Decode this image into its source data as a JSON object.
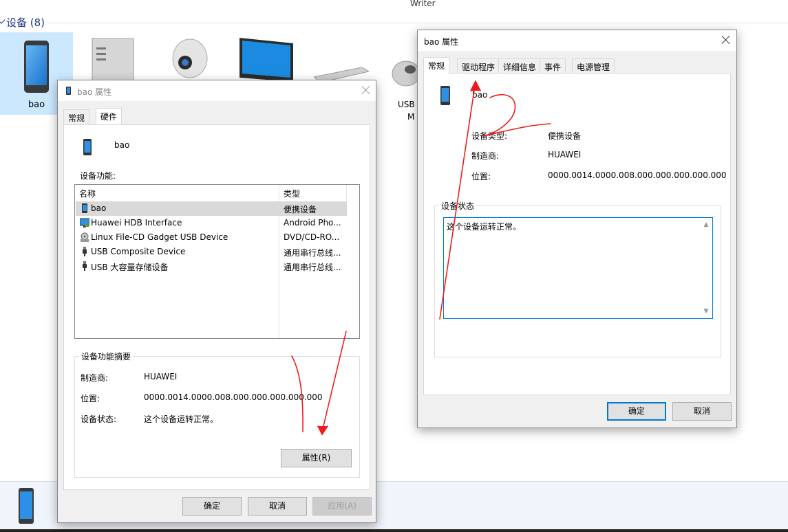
{
  "window": {
    "title": "Writer"
  },
  "section": {
    "header": "设备 (8)"
  },
  "devices": [
    {
      "label": "bao",
      "icon": "phone-icon"
    },
    {
      "label": "",
      "icon": "tower-pc-icon"
    },
    {
      "label": "",
      "icon": "webcam-icon"
    },
    {
      "label": "",
      "icon": "monitor-icon"
    },
    {
      "label": "",
      "icon": "keyboard-icon"
    },
    {
      "label_line1": "USB",
      "label_line2": "M",
      "icon": "mouse-icon"
    }
  ],
  "dialog_left": {
    "title": "bao 属性",
    "tabs": [
      "常规",
      "硬件"
    ],
    "active_tab": "硬件",
    "device_name": "bao",
    "functions_label": "设备功能:",
    "columns": [
      "名称",
      "类型"
    ],
    "rows": [
      {
        "name": "bao",
        "type": "便携设备",
        "icon": "phone-small-icon"
      },
      {
        "name": "Huawei HDB Interface",
        "type": "Android Pho...",
        "icon": "monitor-small-icon"
      },
      {
        "name": "Linux File-CD Gadget USB Device",
        "type": "DVD/CD-RO...",
        "icon": "disc-drive-icon"
      },
      {
        "name": "USB Composite Device",
        "type": "通用串行总线...",
        "icon": "usb-plug-icon"
      },
      {
        "name": "USB 大容量存储设备",
        "type": "通用串行总线...",
        "icon": "usb-plug-icon"
      }
    ],
    "summary": {
      "caption": "设备功能摘要",
      "manufacturer_label": "制造商:",
      "manufacturer": "HUAWEI",
      "location_label": "位置:",
      "location": "0000.0014.0000.008.000.000.000.000.000",
      "status_label": "设备状态:",
      "status": "这个设备运转正常。",
      "properties_button": "属性(R)"
    },
    "buttons": {
      "ok": "确定",
      "cancel": "取消",
      "apply": "应用(A)"
    }
  },
  "dialog_right": {
    "title": "bao 属性",
    "tabs": [
      "常规",
      "驱动程序",
      "详细信息",
      "事件",
      "电源管理"
    ],
    "active_tab": "常规",
    "device_name": "bao",
    "device_type_label": "设备类型:",
    "device_type": "便携设备",
    "manufacturer_label": "制造商:",
    "manufacturer": "HUAWEI",
    "location_label": "位置:",
    "location": "0000.0014.0000.008.000.000.000.000.000",
    "status_caption": "设备状态",
    "status_text": "这个设备运转正常。",
    "buttons": {
      "ok": "确定",
      "cancel": "取消"
    }
  },
  "annotation": {
    "number": "2",
    "color": "#ee1c1c"
  }
}
